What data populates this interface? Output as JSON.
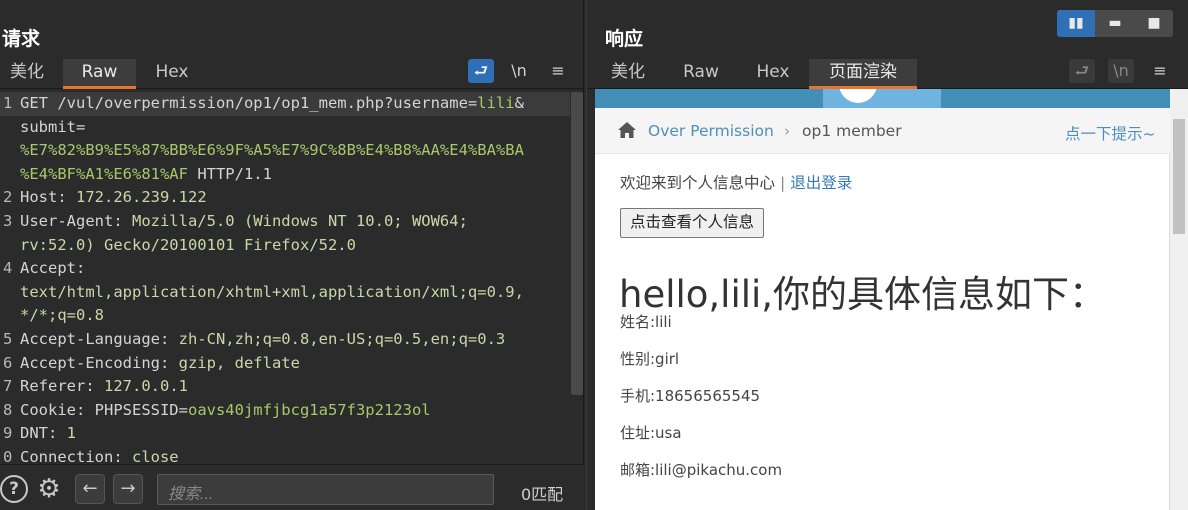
{
  "request": {
    "title": "请求",
    "tabs": [
      "美化",
      "Raw",
      "Hex"
    ],
    "active_tab": "Raw",
    "tool_wrap": "⮐",
    "tool_newline": "\\n",
    "tool_menu": "≡",
    "lines": [
      {
        "n": "1",
        "parts": [
          [
            "GET /vul/overpermission/op1/op1_mem.php?username=",
            "hdr"
          ],
          [
            "lili",
            "url-val"
          ],
          [
            "&",
            "hdr"
          ]
        ]
      },
      {
        "n": "",
        "parts": [
          [
            "submit=",
            "hdr"
          ]
        ]
      },
      {
        "n": "",
        "parts": [
          [
            "%E7%82%B9%E5%87%BB%E6%9F%A5%E7%9C%8B%E4%B8%AA%E4%BA%BA",
            "url-val"
          ]
        ]
      },
      {
        "n": "",
        "parts": [
          [
            "%E4%BF%A1%E6%81%AF",
            "url-val"
          ],
          [
            " HTTP/1.1",
            "hdr"
          ]
        ]
      },
      {
        "n": "2",
        "parts": [
          [
            "Host: ",
            "hdr"
          ],
          [
            "172.26.239.122",
            "val"
          ]
        ]
      },
      {
        "n": "3",
        "parts": [
          [
            "User-Agent: ",
            "hdr"
          ],
          [
            "Mozilla/5.0 (Windows NT 10.0; WOW64;",
            "val"
          ]
        ]
      },
      {
        "n": "",
        "parts": [
          [
            "rv:52.0) Gecko/20100101 Firefox/52.0",
            "val"
          ]
        ]
      },
      {
        "n": "4",
        "parts": [
          [
            "Accept:",
            "hdr"
          ]
        ]
      },
      {
        "n": "",
        "parts": [
          [
            "text/html,application/xhtml+xml,application/xml;q=0.9,",
            "val"
          ]
        ]
      },
      {
        "n": "",
        "parts": [
          [
            "*/*;q=0.8",
            "val"
          ]
        ]
      },
      {
        "n": "5",
        "parts": [
          [
            "Accept-Language: ",
            "hdr"
          ],
          [
            "zh-CN,zh;q=0.8,en-US;q=0.5,en;q=0.3",
            "val"
          ]
        ]
      },
      {
        "n": "6",
        "parts": [
          [
            "Accept-Encoding: ",
            "hdr"
          ],
          [
            "gzip, deflate",
            "val"
          ]
        ]
      },
      {
        "n": "7",
        "parts": [
          [
            "Referer: ",
            "hdr"
          ],
          [
            "127.0.0.1",
            "val"
          ]
        ]
      },
      {
        "n": "8",
        "parts": [
          [
            "Cookie: ",
            "hdr"
          ],
          [
            "PHPSESSID=",
            "hdr"
          ],
          [
            "oavs40jmfjbcg1a57f3p2123ol",
            "url-val"
          ]
        ]
      },
      {
        "n": "9",
        "parts": [
          [
            "DNT: ",
            "hdr"
          ],
          [
            "1",
            "val"
          ]
        ]
      },
      {
        "n": "0",
        "parts": [
          [
            "Connection: ",
            "hdr"
          ],
          [
            "close",
            "val"
          ]
        ]
      }
    ],
    "search_placeholder": "搜索...",
    "match_count": "0匹配"
  },
  "response": {
    "title": "响应",
    "tabs": [
      "美化",
      "Raw",
      "Hex",
      "页面渲染"
    ],
    "active_tab": "页面渲染",
    "render": {
      "breadcrumb_link": "Over Permission",
      "breadcrumb_sep": "›",
      "breadcrumb_current": "op1 member",
      "tip_link": "点一下提示~",
      "welcome": "欢迎来到个人信息中心",
      "separator": "|",
      "logout": "退出登录",
      "view_button": "点击查看个人信息",
      "heading": "hello,lili,你的具体信息如下：",
      "fields": [
        "姓名:lili",
        "性别:girl",
        "手机:18656565545",
        "住址:usa",
        "邮箱:lili@pikachu.com"
      ]
    }
  },
  "colors": {
    "accent": "#e8742b",
    "blue": "#2e6fb5",
    "link": "#4c8fbd"
  }
}
